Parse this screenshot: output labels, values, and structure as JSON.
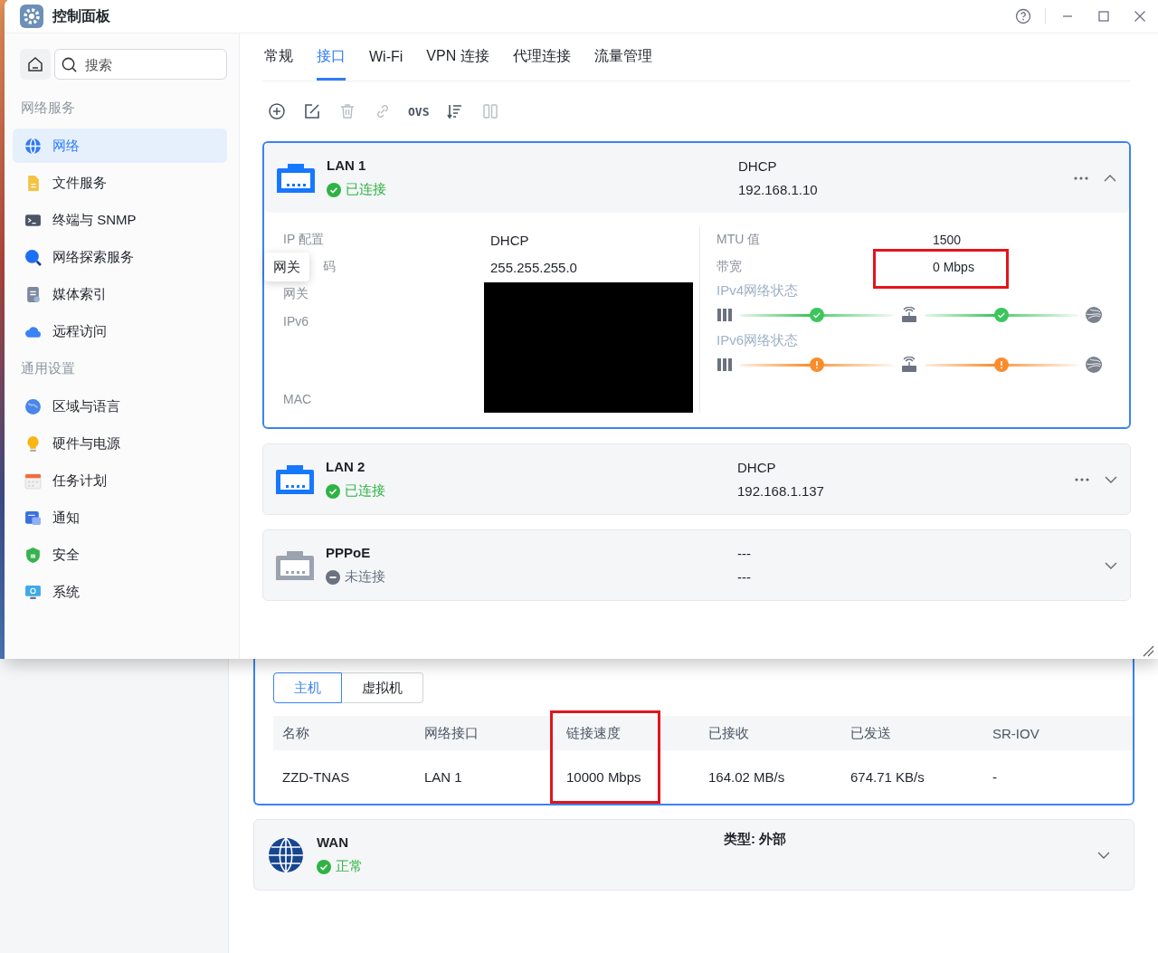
{
  "window": {
    "title": "控制面板"
  },
  "sidebar": {
    "search": {
      "placeholder": "搜索"
    },
    "sections": [
      {
        "heading": "网络服务",
        "items": [
          {
            "label": "网络",
            "selected": true
          },
          {
            "label": "文件服务",
            "selected": false
          },
          {
            "label": "终端与 SNMP",
            "selected": false
          },
          {
            "label": "网络探索服务",
            "selected": false
          },
          {
            "label": "媒体索引",
            "selected": false
          },
          {
            "label": "远程访问",
            "selected": false
          }
        ]
      },
      {
        "heading": "通用设置",
        "items": [
          {
            "label": "区域与语言",
            "selected": false
          },
          {
            "label": "硬件与电源",
            "selected": false
          },
          {
            "label": "任务计划",
            "selected": false
          },
          {
            "label": "通知",
            "selected": false
          },
          {
            "label": "安全",
            "selected": false
          },
          {
            "label": "系统",
            "selected": false
          }
        ]
      }
    ]
  },
  "tabs": [
    {
      "label": "常规",
      "selected": false
    },
    {
      "label": "接口",
      "selected": true
    },
    {
      "label": "Wi-Fi",
      "selected": false
    },
    {
      "label": "VPN 连接",
      "selected": false
    },
    {
      "label": "代理连接",
      "selected": false
    },
    {
      "label": "流量管理",
      "selected": false
    }
  ],
  "toolbar": [
    {
      "kind": "add",
      "disabled": false
    },
    {
      "kind": "edit",
      "disabled": false
    },
    {
      "kind": "delete",
      "disabled": true
    },
    {
      "kind": "link",
      "disabled": true
    },
    {
      "kind": "text",
      "label": "OVS",
      "disabled": false
    },
    {
      "kind": "sort",
      "disabled": false
    },
    {
      "kind": "columns",
      "disabled": true
    }
  ],
  "interfaces": [
    {
      "name": "LAN 1",
      "status": "已连接",
      "connected": true,
      "mode": "DHCP",
      "address": "192.168.1.10",
      "has_menu": true,
      "expanded": true,
      "details": {
        "labels": [
          "IP 配置",
          "码",
          "网关",
          "IPv6",
          "MAC"
        ],
        "values": [
          "DHCP",
          "255.255.255.0"
        ],
        "redacted": true,
        "tooltip": "网关",
        "stats": [
          {
            "label": "MTU 值",
            "value": "1500",
            "highlighted": false
          },
          {
            "label": "带宽",
            "value": "0 Mbps",
            "highlighted": true
          }
        ],
        "paths": [
          {
            "label": "IPv4网络状态",
            "warning": false
          },
          {
            "label": "IPv6网络状态",
            "warning": true
          }
        ]
      }
    },
    {
      "name": "LAN 2",
      "status": "已连接",
      "connected": true,
      "mode": "DHCP",
      "address": "192.168.1.137",
      "has_menu": true,
      "expanded": false
    },
    {
      "name": "PPPoE",
      "status": "未连接",
      "connected": false,
      "mode": "---",
      "address": "---",
      "has_menu": false,
      "expanded": false
    }
  ],
  "lower": {
    "tabs": [
      {
        "label": "主机",
        "selected": true
      },
      {
        "label": "虚拟机",
        "selected": false
      }
    ],
    "columns": [
      {
        "label": "名称",
        "highlighted": false
      },
      {
        "label": "网络接口",
        "highlighted": false
      },
      {
        "label": "链接速度",
        "highlighted": true
      },
      {
        "label": "已接收",
        "highlighted": false
      },
      {
        "label": "已发送",
        "highlighted": false
      },
      {
        "label": "SR-IOV",
        "highlighted": false
      }
    ],
    "rows": [
      [
        "ZZD-TNAS",
        "LAN 1",
        "10000 Mbps",
        "164.02 MB/s",
        "674.71 KB/s",
        "-"
      ]
    ],
    "wan": {
      "name": "WAN",
      "status": "正常",
      "connected": true,
      "type_label": "类型: 外部",
      "expanded": false
    }
  }
}
